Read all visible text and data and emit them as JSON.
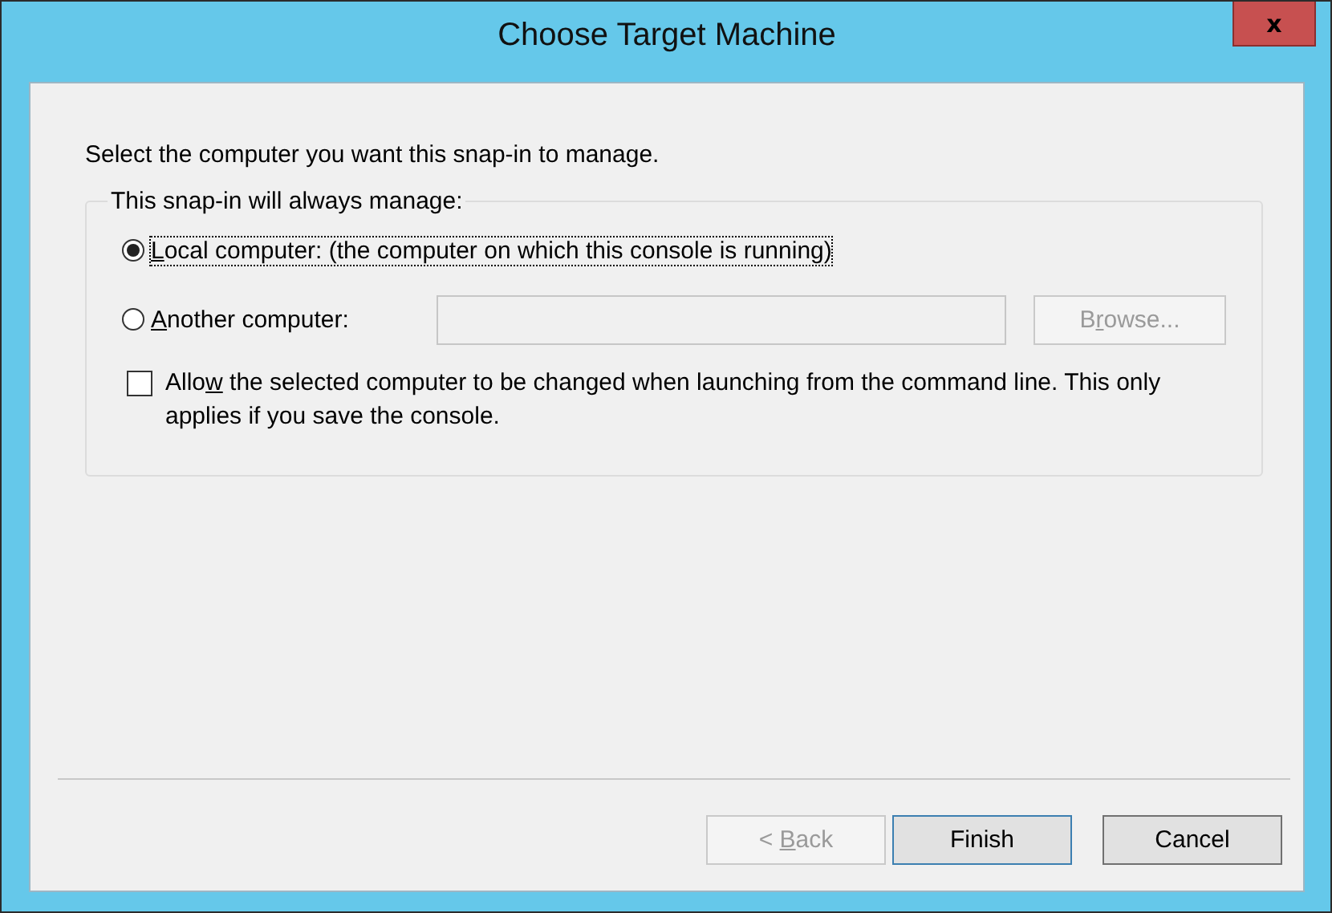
{
  "window": {
    "title": "Choose Target Machine",
    "close": "x"
  },
  "intro": "Select the computer you want this snap-in to manage.",
  "group": {
    "legend": "This snap-in will always manage:",
    "options": [
      {
        "kind": "radio",
        "key": "L",
        "post": "ocal computer:  (the computer on which this console is running)",
        "selected": true,
        "focused": true
      },
      {
        "kind": "radio",
        "key": "A",
        "post": "nother computer:",
        "selected": false,
        "focused": false
      }
    ],
    "computer_field": {
      "disabled": true
    },
    "browse": {
      "pre": "B",
      "key": "r",
      "post": "owse...",
      "disabled": true
    },
    "allow": {
      "pre": "Allo",
      "key": "w",
      "post": " the selected computer to be changed when launching from the command line. This only applies if you save the console.",
      "checked": false
    }
  },
  "buttons": [
    {
      "pre": "< ",
      "key": "B",
      "post": "ack",
      "disabled": true,
      "default": false
    },
    {
      "pre": "Finish",
      "disabled": false,
      "default": true
    },
    {
      "pre": "Cancel",
      "disabled": false,
      "default": false
    }
  ]
}
